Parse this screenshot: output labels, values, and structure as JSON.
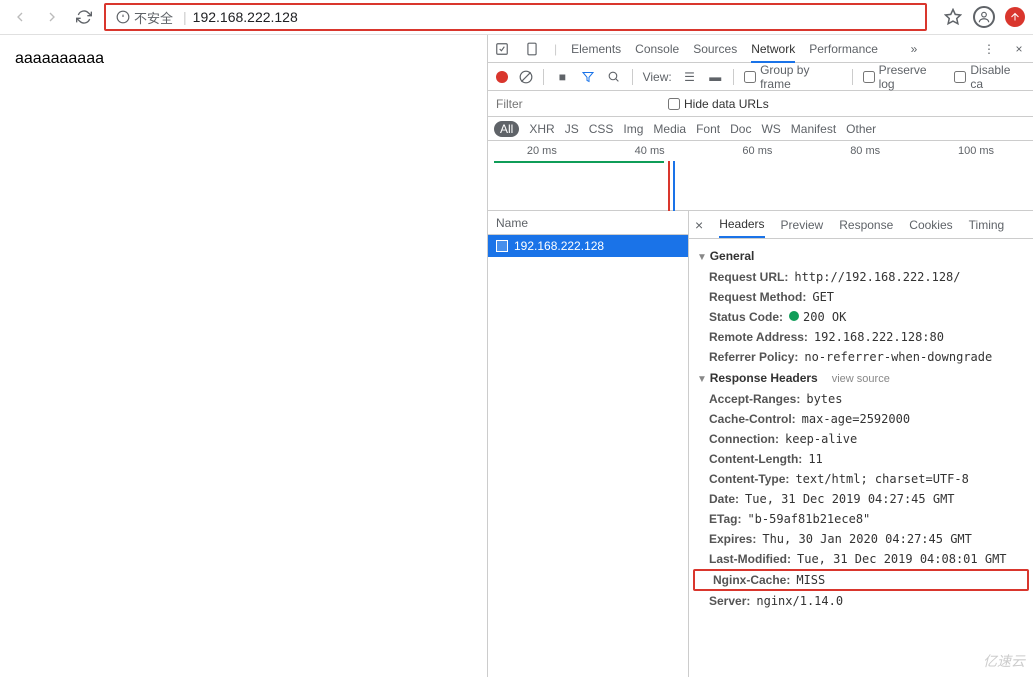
{
  "url_bar": {
    "security_label": "不安全",
    "url": "192.168.222.128"
  },
  "page_body": "aaaaaaaaaa",
  "devtools": {
    "tabs": [
      "Elements",
      "Console",
      "Sources",
      "Network",
      "Performance"
    ],
    "active_tab": "Network",
    "bar2": {
      "view_label": "View:",
      "group_by_frame": "Group by frame",
      "preserve_log": "Preserve log",
      "disable_cache": "Disable ca"
    },
    "filter_placeholder": "Filter",
    "hide_data_urls": "Hide data URLs",
    "type_filters": [
      "All",
      "XHR",
      "JS",
      "CSS",
      "Img",
      "Media",
      "Font",
      "Doc",
      "WS",
      "Manifest",
      "Other"
    ],
    "waterfall_ticks": [
      "20 ms",
      "40 ms",
      "60 ms",
      "80 ms",
      "100 ms"
    ],
    "req_header": "Name",
    "requests": [
      {
        "name": "192.168.222.128"
      }
    ],
    "detail_tabs": [
      "Headers",
      "Preview",
      "Response",
      "Cookies",
      "Timing"
    ],
    "active_detail_tab": "Headers",
    "sections": {
      "general": {
        "title": "General",
        "rows": [
          {
            "k": "Request URL:",
            "v": "http://192.168.222.128/"
          },
          {
            "k": "Request Method:",
            "v": "GET"
          },
          {
            "k": "Status Code:",
            "v": "200 OK",
            "status": true
          },
          {
            "k": "Remote Address:",
            "v": "192.168.222.128:80"
          },
          {
            "k": "Referrer Policy:",
            "v": "no-referrer-when-downgrade"
          }
        ]
      },
      "response": {
        "title": "Response Headers",
        "view_source": "view source",
        "rows": [
          {
            "k": "Accept-Ranges:",
            "v": "bytes"
          },
          {
            "k": "Cache-Control:",
            "v": "max-age=2592000"
          },
          {
            "k": "Connection:",
            "v": "keep-alive"
          },
          {
            "k": "Content-Length:",
            "v": "11"
          },
          {
            "k": "Content-Type:",
            "v": "text/html; charset=UTF-8"
          },
          {
            "k": "Date:",
            "v": "Tue, 31 Dec 2019 04:27:45 GMT"
          },
          {
            "k": "ETag:",
            "v": "\"b-59af81b21ece8\""
          },
          {
            "k": "Expires:",
            "v": "Thu, 30 Jan 2020 04:27:45 GMT"
          },
          {
            "k": "Last-Modified:",
            "v": "Tue, 31 Dec 2019 04:08:01 GMT"
          },
          {
            "k": "Nginx-Cache:",
            "v": "MISS",
            "highlight": true
          },
          {
            "k": "Server:",
            "v": "nginx/1.14.0"
          }
        ]
      }
    }
  },
  "watermark": "亿速云"
}
